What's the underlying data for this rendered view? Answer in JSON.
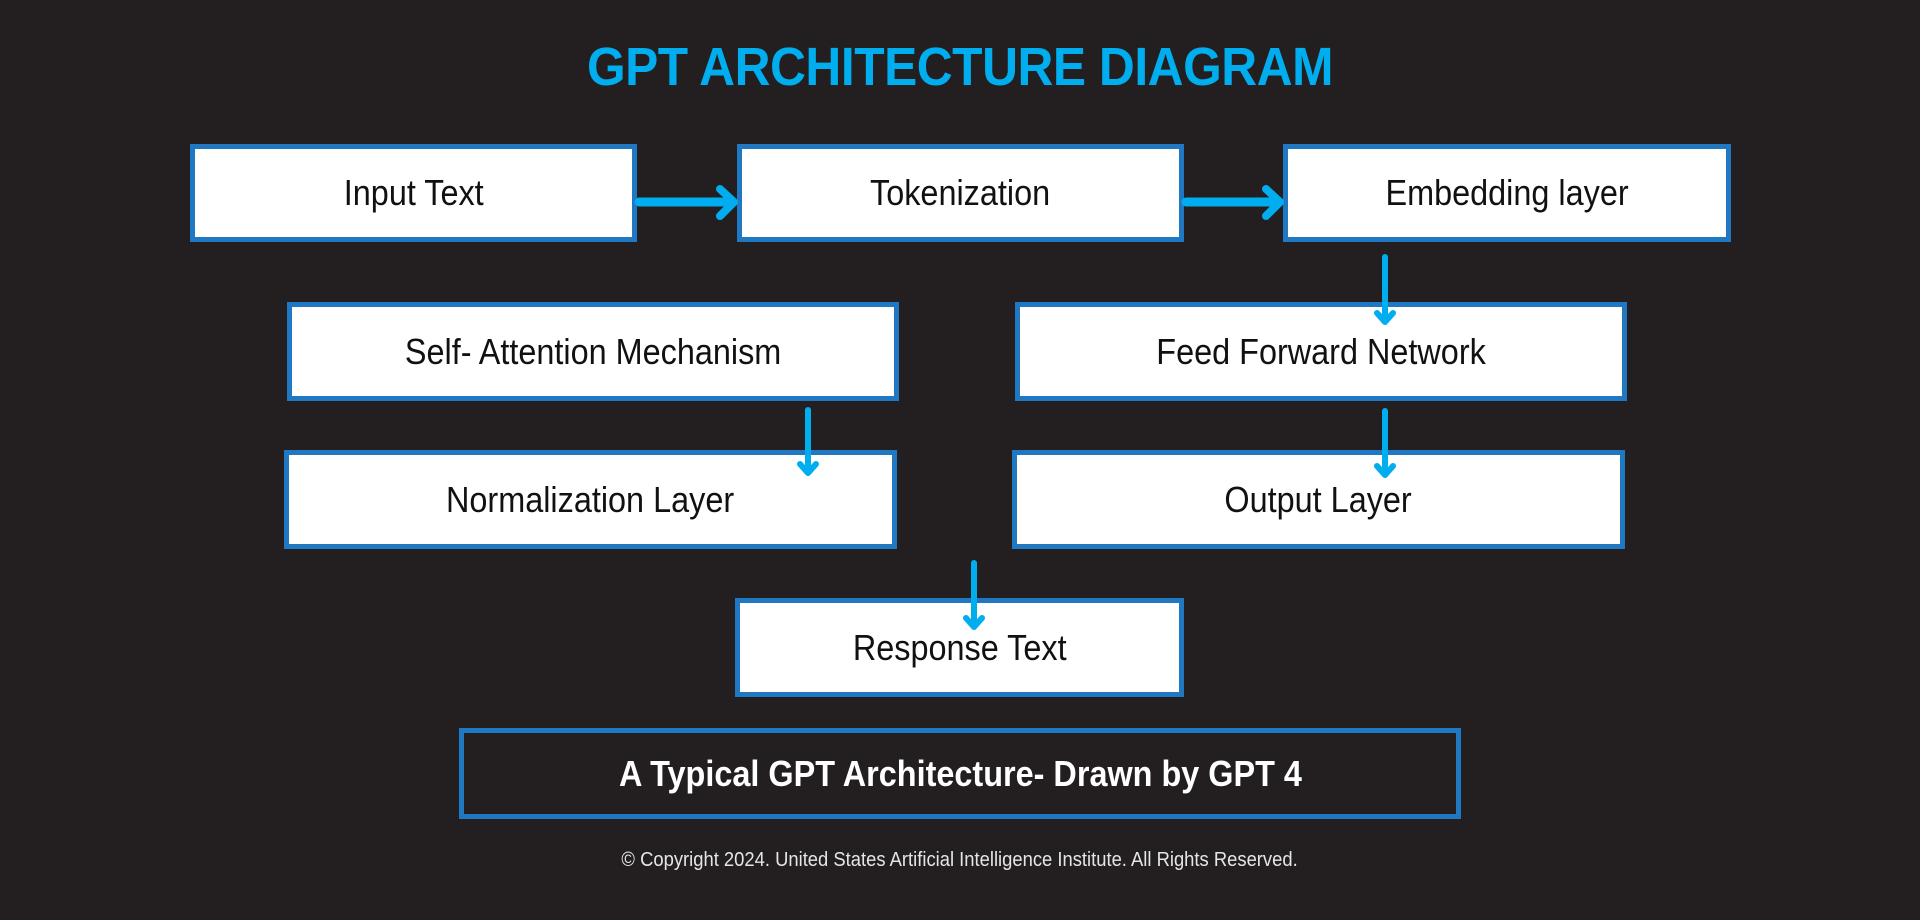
{
  "title": "GPT ARCHITECTURE DIAGRAM",
  "nodes": {
    "input_text": "Input Text",
    "tokenization": "Tokenization",
    "embedding_layer": "Embedding layer",
    "self_attention": "Self- Attention Mechanism",
    "feed_forward": "Feed Forward Network",
    "normalization": "Normalization Layer",
    "output_layer": "Output Layer",
    "response_text": "Response Text"
  },
  "edges": [
    {
      "from": "Input Text",
      "to": "Tokenization"
    },
    {
      "from": "Tokenization",
      "to": "Embedding layer"
    },
    {
      "from": "Embedding layer",
      "to": "Feed Forward Network"
    },
    {
      "from": "Self- Attention Mechanism",
      "to": "Normalization Layer"
    },
    {
      "from": "Feed Forward Network",
      "to": "Output Layer"
    },
    {
      "from": "Normalization Layer",
      "to": "Response Text"
    }
  ],
  "caption": "A Typical GPT Architecture- Drawn by GPT 4",
  "footer": "© Copyright 2024. United States Artificial Intelligence Institute. All Rights Reserved.",
  "colors": {
    "background": "#231f20",
    "accent": "#00aeef",
    "box_border": "#1f78c1",
    "box_fill": "#ffffff"
  }
}
